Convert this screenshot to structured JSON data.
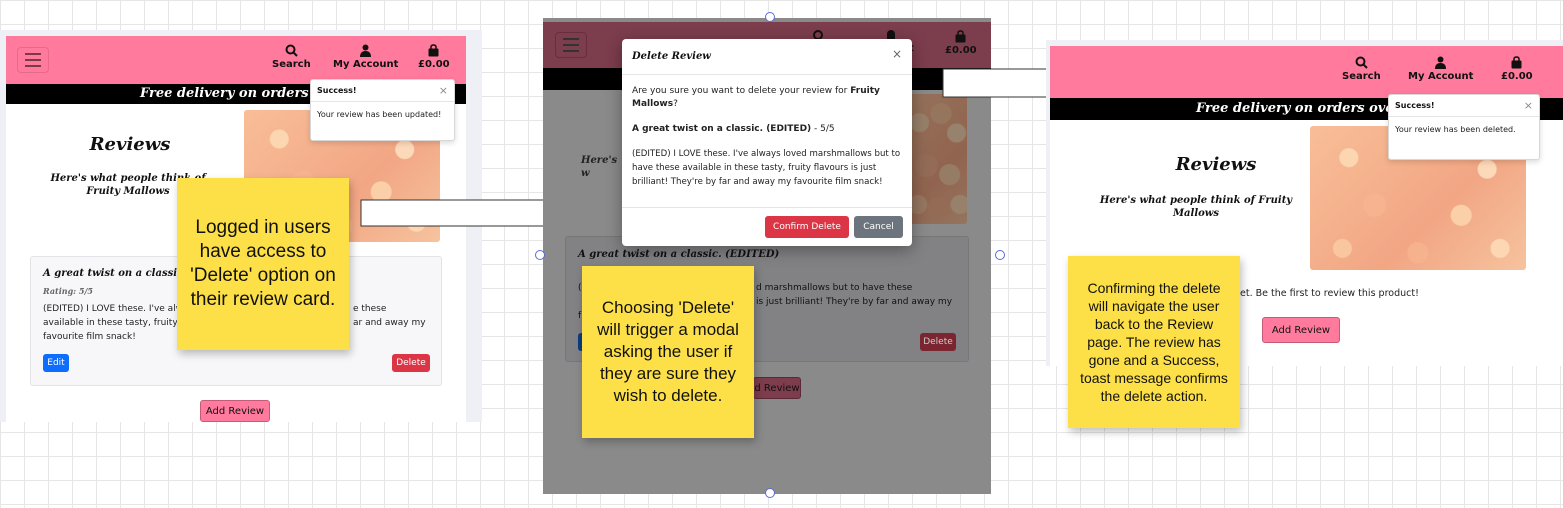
{
  "header": {
    "search_label": "Search",
    "account_label": "My Account",
    "bag_label": "£0.00"
  },
  "banner_text": "Free delivery on orders over £",
  "reviews_page": {
    "title": "Reviews",
    "subtitle": "Here's what people think of Fruity Mallows",
    "add_review_label": "Add Review"
  },
  "panel1": {
    "toast": {
      "title": "Success!",
      "close": "×",
      "message": "Your review has been updated!"
    },
    "review_card": {
      "title": "A great twist on a classic. (E",
      "rating": "Rating: 5/5",
      "body_line1": "(EDITED) I LOVE these. I've alw",
      "body_line1_tail": "e these",
      "body_line2": "available in these tasty, fruity",
      "body_line2_tail": "ar and away my",
      "body_line3": "favourite film snack!",
      "edit_label": "Edit",
      "delete_label": "Delete"
    },
    "note": "Logged in users have access to 'Delete' option on their review card."
  },
  "panel2": {
    "header_tail": "t",
    "subtitle_fragment": "Here's w",
    "modal": {
      "title": "Delete Review",
      "close": "×",
      "question_pre": "Are you sure you want to delete your review for ",
      "question_bold": "Fruity Mallows",
      "question_post": "?",
      "review_title": "A great twist on a classic. (EDITED)",
      "review_score": " - 5/5",
      "review_body": "(EDITED) I LOVE these. I've always loved marshmallows but to have these available in these tasty, fruity flavours is just brilliant! They're by far and away my favourite film snack!",
      "confirm_label": "Confirm Delete",
      "cancel_label": "Cancel"
    },
    "card_title": "A great twist on a classic. (EDITED)",
    "card_line1": "d marshmallows but to have these",
    "card_line2": "is just brilliant! They're by far and away my",
    "card_first_char": "(",
    "card_f": "f",
    "delete_label": "Delete",
    "add_review_fragment": "d Review",
    "note": "Choosing 'Delete' will trigger a modal asking the user if they are sure they wish to delete."
  },
  "panel3": {
    "toast": {
      "title": "Success!",
      "close": "×",
      "message": "Your review has been deleted."
    },
    "empty_fragment": "et. Be the first to review this product!",
    "note": "Confirming the delete will navigate the user back to the Review page. The review has gone and a Success, toast message confirms the delete action."
  },
  "colors": {
    "brand_pink": "#ff7a9c",
    "sticky_yellow": "#fde047",
    "danger_red": "#dc3545",
    "primary_blue": "#0d6efd"
  }
}
